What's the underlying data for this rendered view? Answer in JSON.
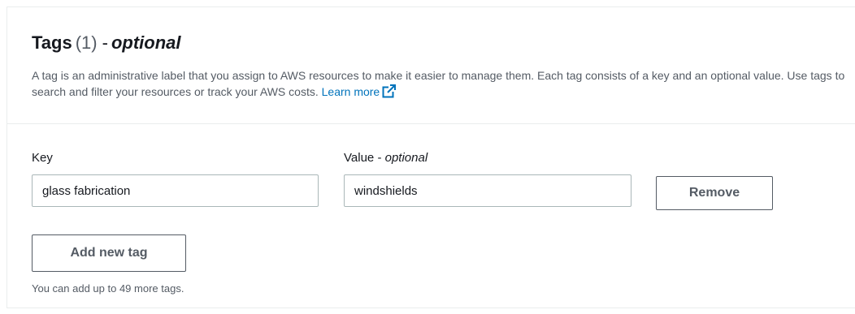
{
  "header": {
    "title": "Tags",
    "count": "(1)",
    "separator": "-",
    "optional": "optional",
    "description_text": "A tag is an administrative label that you assign to AWS resources to make it easier to manage them. Each tag consists of a key and an optional value. Use tags to search and filter your resources or track your AWS costs.",
    "learn_more": "Learn more",
    "learn_more_icon": "external-link-icon"
  },
  "tags": {
    "key_label": "Key",
    "value_label": "Value",
    "value_label_separator": "-",
    "value_label_optional": "optional",
    "rows": [
      {
        "key": "glass fabrication",
        "value": "windshields",
        "remove_label": "Remove"
      }
    ],
    "add_label": "Add new tag",
    "hint": "You can add up to 49 more tags."
  },
  "colors": {
    "link": "#0073bb",
    "text": "#16191f",
    "secondary_text": "#545b64",
    "border": "#aab7b8"
  }
}
